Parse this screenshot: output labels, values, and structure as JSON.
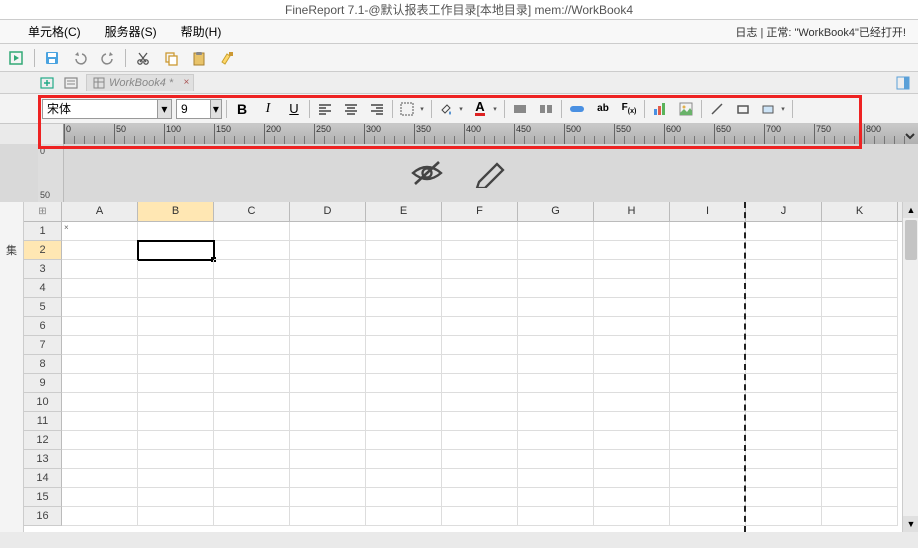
{
  "title": "FineReport 7.1-@默认报表工作目录[本地目录]    mem://WorkBook4",
  "menu": {
    "cell": "单元格(C)",
    "server": "服务器(S)",
    "help": "帮助(H)"
  },
  "status": "日志  |  正常: \"WorkBook4\"已经打开!",
  "tab": {
    "name": "WorkBook4 *"
  },
  "font": {
    "family": "宋体",
    "size": "9"
  },
  "ruler_labels": [
    "0",
    "50",
    "100",
    "150",
    "200",
    "250",
    "300",
    "350",
    "400",
    "450",
    "500",
    "550",
    "600",
    "650",
    "700",
    "750",
    "800"
  ],
  "vruler": [
    "0",
    "50"
  ],
  "cols": [
    "A",
    "B",
    "C",
    "D",
    "E",
    "F",
    "G",
    "H",
    "I",
    "J",
    "K"
  ],
  "rows": [
    "1",
    "2",
    "3",
    "4",
    "5",
    "6",
    "7",
    "8",
    "9",
    "10",
    "11",
    "12",
    "13",
    "14",
    "15",
    "16"
  ],
  "selected": {
    "col": "B",
    "row": "2"
  },
  "side_label": "集"
}
